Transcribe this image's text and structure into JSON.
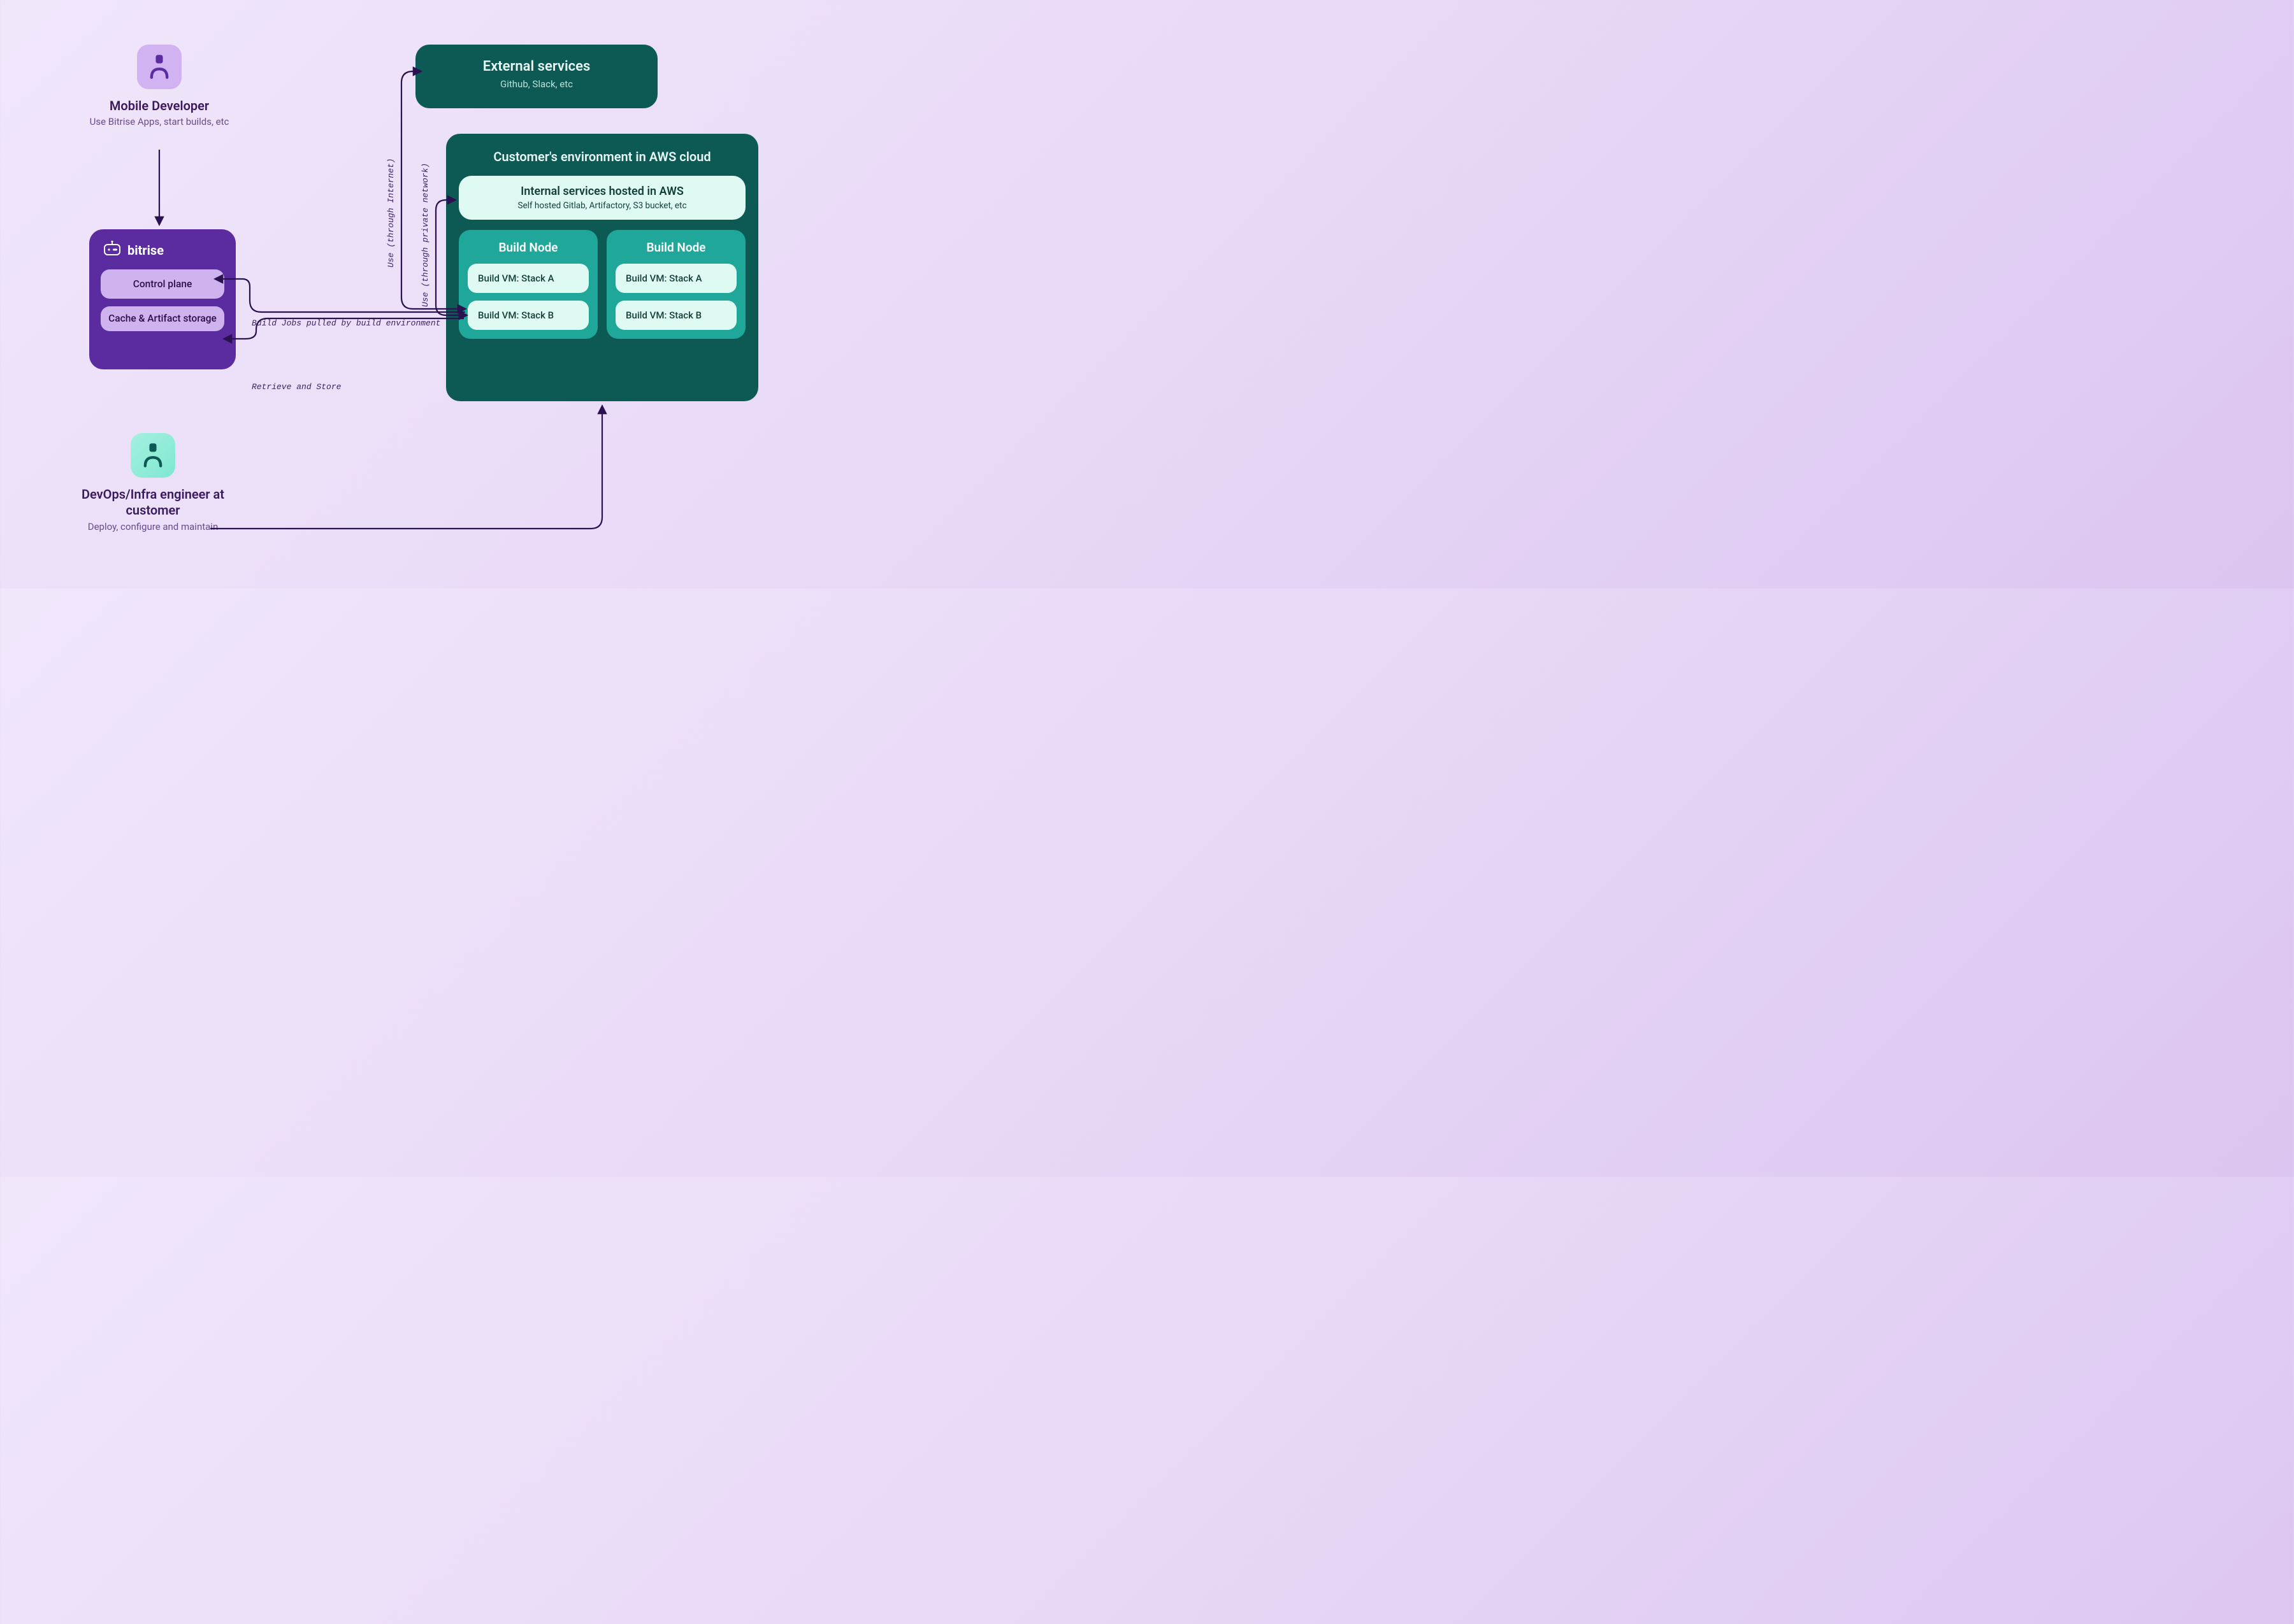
{
  "actors": {
    "mobile": {
      "title": "Mobile Developer",
      "sub": "Use Bitrise Apps, start builds, etc"
    },
    "devops": {
      "title": "DevOps/Infra engineer at customer",
      "sub": "Deploy, configure and maintain"
    }
  },
  "external": {
    "title": "External services",
    "sub": "Github, Slack, etc"
  },
  "customer_env": {
    "title": "Customer's environment in AWS cloud",
    "internal": {
      "title": "Internal services hosted in AWS",
      "sub": "Self hosted Gitlab, Artifactory, S3 bucket, etc"
    },
    "nodes": [
      {
        "title": "Build Node",
        "vms": [
          "Build VM: Stack A",
          "Build VM: Stack B"
        ]
      },
      {
        "title": "Build Node",
        "vms": [
          "Build VM: Stack A",
          "Build VM: Stack B"
        ]
      }
    ]
  },
  "bitrise": {
    "brand": "bitrise",
    "items": [
      "Control plane",
      "Cache & Artifact storage"
    ]
  },
  "edges": {
    "use_internet": "Use (through Internet)",
    "use_private": "Use (through private network)",
    "build_jobs": "Build Jobs pulled by build environment",
    "retrieve_store": "Retrieve and Store"
  }
}
